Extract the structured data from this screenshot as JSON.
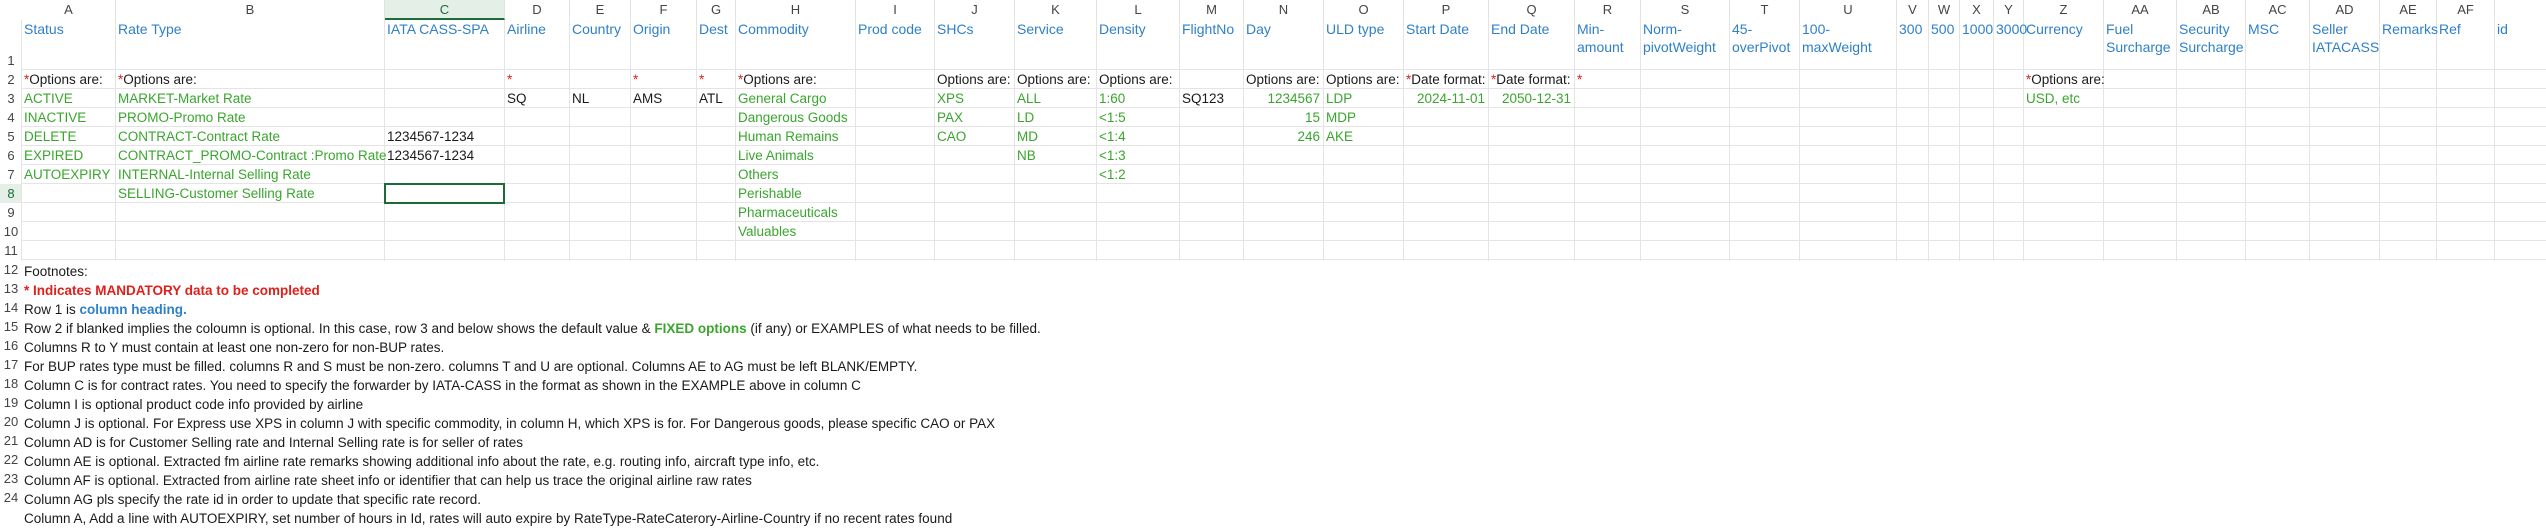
{
  "columns": [
    "A",
    "B",
    "C",
    "D",
    "E",
    "F",
    "G",
    "H",
    "I",
    "J",
    "K",
    "L",
    "M",
    "N",
    "O",
    "P",
    "Q",
    "R",
    "S",
    "T",
    "U",
    "V",
    "W",
    "X",
    "Y",
    "Z",
    "AA",
    "AB",
    "AC",
    "AD",
    "AE",
    "AF"
  ],
  "selected_column": "C",
  "selected_row": "8",
  "row_numbers": [
    "1",
    "2",
    "3",
    "4",
    "5",
    "6",
    "7",
    "8",
    "9",
    "10",
    "11",
    "12",
    "13",
    "14",
    "15",
    "16",
    "17",
    "18",
    "19",
    "20",
    "21",
    "22",
    "23",
    "24"
  ],
  "headers": {
    "A": "Status",
    "B": "Rate Type",
    "C": "IATA CASS-SPA",
    "D": "Airline",
    "E": "Country",
    "F": "Origin",
    "G": "Dest",
    "H": "Commodity",
    "I": "Prod code",
    "J": "SHCs",
    "K": "Service",
    "L": "Density",
    "M": "FlightNo",
    "N": "Day",
    "O": "ULD type",
    "P": "Start Date",
    "Q": "End Date",
    "R": "Min-amount",
    "S": "Norm-pivotWeight",
    "T": "45-overPivot",
    "U": "100-maxWeight",
    "V": "300",
    "W": "500",
    "X": "1000",
    "Y": "3000",
    "Z": "Currency",
    "AA": "Fuel Surcharge",
    "AB": "Security Surcharge",
    "AC": "MSC",
    "AD": "Seller IATACASS",
    "AE": "Remarks",
    "AF": "Ref",
    "AG": "id"
  },
  "row2": {
    "A": "*Options are:",
    "B": "*Options are:",
    "D": "*",
    "F": "*",
    "G": "*",
    "H": "*Options are:",
    "J": "Options are:",
    "K": "Options are:",
    "L": "Options are:",
    "N": "Options are:",
    "O": "Options are:",
    "P": "*Date format:",
    "Q": "*Date format:",
    "R": "*",
    "Z": "*Options are:"
  },
  "row3": {
    "A": "ACTIVE",
    "B": "MARKET-Market Rate",
    "D": "SQ",
    "E": "NL",
    "F": "AMS",
    "G": "ATL",
    "H": "General Cargo",
    "J": "XPS",
    "K": "ALL",
    "L": "1:60",
    "M": "SQ123",
    "N": "1234567",
    "O": "LDP",
    "P": "2024-11-01",
    "Q": "2050-12-31",
    "Z": "USD, etc"
  },
  "row4": {
    "A": "INACTIVE",
    "B": "PROMO-Promo Rate",
    "H": "Dangerous Goods",
    "J": "PAX",
    "K": "LD",
    "L": "<1:5",
    "N": "15",
    "O": "MDP"
  },
  "row5": {
    "A": "DELETE",
    "B": "CONTRACT-Contract Rate",
    "C": "1234567-1234",
    "H": "Human Remains",
    "J": "CAO",
    "K": "MD",
    "L": "<1:4",
    "N": "246",
    "O": "AKE"
  },
  "row6": {
    "A": "EXPIRED",
    "B": "CONTRACT_PROMO-Contract :Promo Rate",
    "C": "1234567-1234",
    "H": "Live Animals",
    "K": "NB",
    "L": "<1:3"
  },
  "row7": {
    "A": "AUTOEXPIRY",
    "B": "INTERNAL-Internal Selling Rate",
    "H": "Others",
    "L": "<1:2"
  },
  "row8": {
    "B": "SELLING-Customer Selling Rate",
    "H": "Perishable"
  },
  "row9": {
    "H": "Pharmaceuticals"
  },
  "row10": {
    "H": "Valuables"
  },
  "footnotes": {
    "r11": "Footnotes:",
    "r12": "* Indicates MANDATORY data to be completed",
    "r13_a": "Row 1 is ",
    "r13_b": "column heading.",
    "r14_a": "Row 2 if blanked implies the coloumn is optional. In this case, row 3 and below shows the default value & ",
    "r14_b": "FIXED options",
    "r14_c": " (if any) or EXAMPLES of what needs to be filled.",
    "r15": "Columns R to Y must contain at least one non-zero for non-BUP rates.",
    "r16": "For BUP rates type must be filled. columns R and S must be non-zero. columns T and U are optional. Columns AE to AG must be left BLANK/EMPTY.",
    "r17": "Column C is for contract rates. You need to specify the forwarder by IATA-CASS in the format as shown in the EXAMPLE above in column C",
    "r18": "Column I is optional product code info provided by airline",
    "r19": "Column J is optional. For Express use XPS in column J with specific commodity, in column H, which XPS is for. For Dangerous goods, please specific CAO or PAX",
    "r20": "Column AD is for Customer Selling rate and Internal Selling rate is for seller of rates",
    "r21": "Column AE is optional. Extracted fm airline rate remarks showing additional info about the rate, e.g. routing info, aircraft type info, etc.",
    "r22": "Column AF is optional. Extracted from airline rate sheet info or identifier that can help us trace the original airline raw rates",
    "r23": "Column AG pls specify the rate id  in order to update that specific rate record.",
    "r24": "Column A, Add a line with AUTOEXPIRY, set number of hours in Id, rates will auto expire by RateType-RateCaterory-Airline-Country if no recent rates found"
  },
  "colors": {
    "header_blue": "#2f80c8",
    "option_green": "#3aa52e",
    "mandatory_red": "#e0201a",
    "selection_green": "#1e6b3a"
  }
}
